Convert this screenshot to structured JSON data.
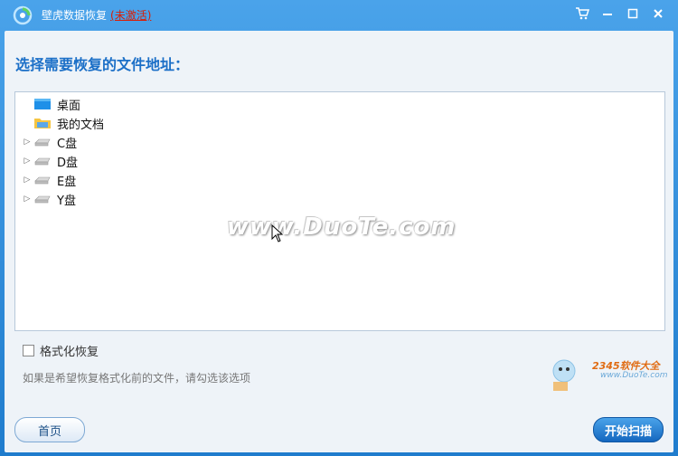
{
  "titlebar": {
    "title": "壁虎数据恢复",
    "activation": "(未激活)"
  },
  "main": {
    "heading": "选择需要恢复的文件地址：",
    "tree": [
      {
        "label": "桌面",
        "icon": "desktop-folder-icon",
        "expandable": false
      },
      {
        "label": "我的文档",
        "icon": "documents-folder-icon",
        "expandable": false
      },
      {
        "label": "C盘",
        "icon": "drive-icon",
        "expandable": true
      },
      {
        "label": "D盘",
        "icon": "drive-icon",
        "expandable": true
      },
      {
        "label": "E盘",
        "icon": "drive-icon",
        "expandable": true
      },
      {
        "label": "Y盘",
        "icon": "drive-icon",
        "expandable": true
      }
    ],
    "format_recover_label": "格式化恢复",
    "format_recover_checked": false,
    "hint": "如果是希望恢复格式化前的文件，请勾选该选项"
  },
  "footer": {
    "home_button": "首页",
    "scan_button": "开始扫描"
  },
  "watermark": {
    "text": "www.DuoTe.com",
    "brand": "2345软件大全",
    "brand_url": "www.DuoTe.com"
  },
  "colors": {
    "titlebar": "#2a86d4",
    "heading": "#1b6fc7",
    "inactive": "#d81e06"
  }
}
